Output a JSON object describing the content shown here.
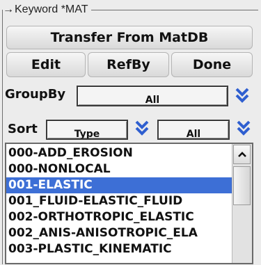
{
  "panel": {
    "title_arrow": "→",
    "title": "Keyword *MAT"
  },
  "buttons": {
    "transfer": "Transfer From MatDB",
    "edit": "Edit",
    "refby": "RefBy",
    "done": "Done"
  },
  "groupby": {
    "label": "GroupBy",
    "value": "All"
  },
  "sort": {
    "label": "Sort",
    "value": "Type",
    "filter_value": "All"
  },
  "icons": {
    "chevron": "double-chevron-down-icon",
    "scroll_up": "scroll-up-arrow-icon",
    "chevron_color": "#2f5fd0"
  },
  "keyword_list": {
    "selected_index": 2,
    "items": [
      "000-ADD_EROSION",
      "000-NONLOCAL",
      "001-ELASTIC",
      "001_FLUID-ELASTIC_FLUID",
      "002-ORTHOTROPIC_ELASTIC",
      "002_ANIS-ANISOTROPIC_ELA",
      "003-PLASTIC_KINEMATIC"
    ]
  }
}
